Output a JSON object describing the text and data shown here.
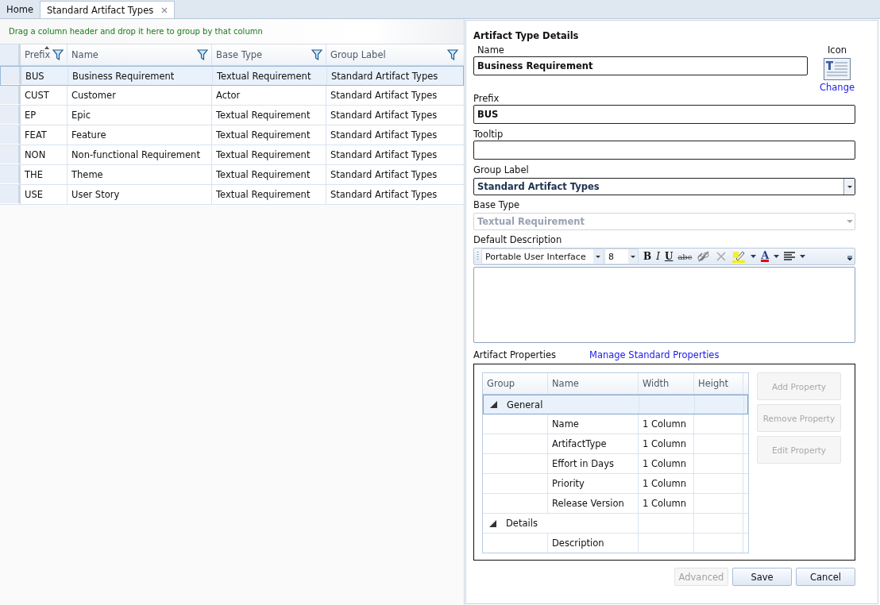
{
  "tabs": [
    {
      "label": "Home",
      "selected": false,
      "closable": false
    },
    {
      "label": "Standard Artifact Types",
      "selected": true,
      "closable": true
    }
  ],
  "grid": {
    "group_hint": "Drag a column header and drop it here to group by that column",
    "columns": [
      {
        "label": "Prefix",
        "sorted": true
      },
      {
        "label": "Name",
        "sorted": false
      },
      {
        "label": "Base Type",
        "sorted": false
      },
      {
        "label": "Group Label",
        "sorted": false
      }
    ],
    "rows": [
      {
        "cells": [
          "BUS",
          "Business Requirement",
          "Textual Requirement",
          "Standard Artifact Types"
        ],
        "selected": true
      },
      {
        "cells": [
          "CUST",
          "Customer",
          "Actor",
          "Standard Artifact Types"
        ],
        "selected": false
      },
      {
        "cells": [
          "EP",
          "Epic",
          "Textual Requirement",
          "Standard Artifact Types"
        ],
        "selected": false
      },
      {
        "cells": [
          "FEAT",
          "Feature",
          "Textual Requirement",
          "Standard Artifact Types"
        ],
        "selected": false
      },
      {
        "cells": [
          "NON",
          "Non-functional Requirement",
          "Textual Requirement",
          "Standard Artifact Types"
        ],
        "selected": false
      },
      {
        "cells": [
          "THE",
          "Theme",
          "Textual Requirement",
          "Standard Artifact Types"
        ],
        "selected": false
      },
      {
        "cells": [
          "USE",
          "User Story",
          "Textual Requirement",
          "Standard Artifact Types"
        ],
        "selected": false
      }
    ]
  },
  "details": {
    "title": "Artifact Type Details",
    "name": {
      "label": "Name",
      "value": "Business Requirement"
    },
    "icon": {
      "label": "Icon",
      "link": "Change"
    },
    "prefix": {
      "label": "Prefix",
      "value": "BUS"
    },
    "tooltip": {
      "label": "Tooltip"
    },
    "group_label": {
      "label": "Group Label",
      "value": "Standard Artifact Types",
      "disabled": false
    },
    "base_type": {
      "label": "Base Type",
      "value": "Textual Requirement",
      "disabled": true
    },
    "description": {
      "label": "Default Description",
      "font": "Portable User Interface",
      "size": "8",
      "format_buttons": [
        {
          "label": "B",
          "kind": "bold"
        },
        {
          "label": "I",
          "kind": "italic"
        },
        {
          "label": "U",
          "kind": "underline"
        },
        {
          "label": "abc",
          "kind": "strike"
        }
      ],
      "color_label": "A"
    },
    "properties": {
      "label": "Artifact Properties",
      "link": "Manage Standard Properties",
      "columns": [
        "Group",
        "Name",
        "Width",
        "Height"
      ],
      "groups": [
        {
          "name": "General",
          "expanded": true,
          "selected": true,
          "children": [
            {
              "name": "Name",
              "width": "1 Column"
            },
            {
              "name": "ArtifactType",
              "width": "1 Column"
            },
            {
              "name": "Effort in Days",
              "width": "1 Column"
            },
            {
              "name": "Priority",
              "width": "1 Column"
            },
            {
              "name": "Release Version",
              "width": "1 Column"
            }
          ]
        },
        {
          "name": "Details",
          "expanded": true,
          "selected": false,
          "children": [
            {
              "name": "Description"
            }
          ]
        }
      ],
      "buttons": [
        {
          "label": "Add Property",
          "disabled": true
        },
        {
          "label": "Remove Property",
          "disabled": true
        },
        {
          "label": "Edit Property",
          "disabled": true
        }
      ]
    },
    "footer": [
      {
        "label": "Advanced",
        "disabled": true
      },
      {
        "label": "Save",
        "disabled": false
      },
      {
        "label": "Cancel",
        "disabled": false
      }
    ]
  }
}
